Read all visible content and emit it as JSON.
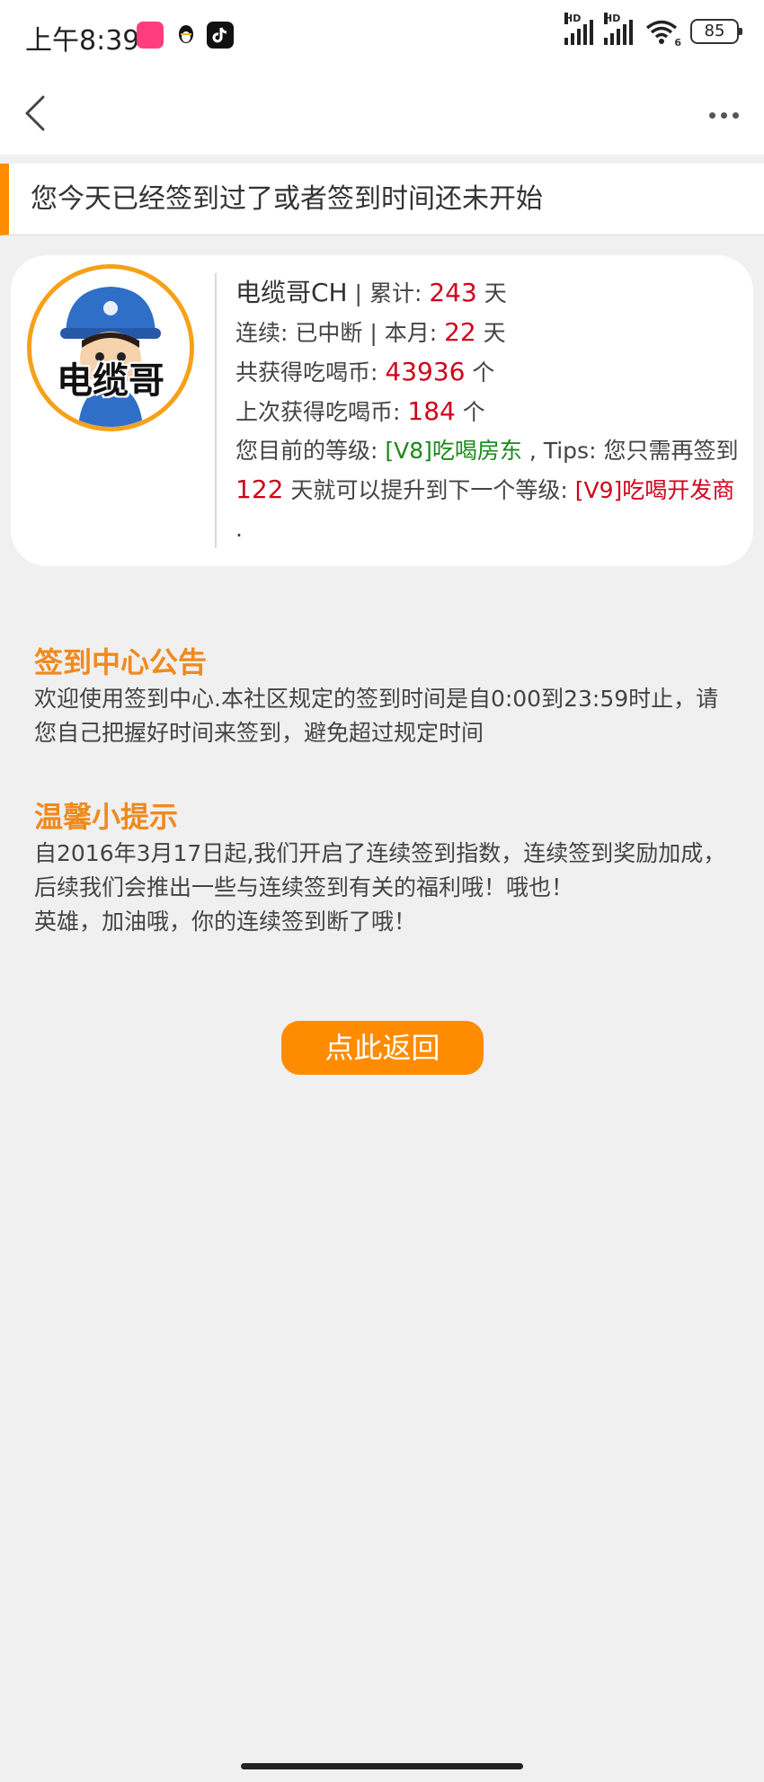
{
  "status_bar": {
    "time": "上午8:39",
    "battery": "85",
    "hd_label": "HD",
    "wifi_label": "6"
  },
  "notice": "您今天已经签到过了或者签到时间还未开始",
  "user": {
    "name": "电缆哥CH",
    "avatar_text": "电缆哥",
    "sep": " | ",
    "total_label": "累计: ",
    "total_days": "243",
    "day_unit": " 天",
    "streak_label": "连续: 已中断",
    "month_label": "本月: ",
    "month_days": "22",
    "coins_label": "共获得吃喝币: ",
    "coins": "43936",
    "coin_unit": " 个",
    "last_label": "上次获得吃喝币: ",
    "last_coins": "184",
    "level_label": "您目前的等级: ",
    "level": "[V8]吃喝房东",
    "tips_label": " , Tips: 您只需再签到 ",
    "days_needed": "122",
    "tips_mid": " 天就可以提升到下一个等级: ",
    "next_level": "[V9]吃喝开发商",
    "tips_end": " ."
  },
  "announcement": {
    "title": "签到中心公告",
    "text": "欢迎使用签到中心.本社区规定的签到时间是自0:00到23:59时止，请您自己把握好时间来签到，避免超过规定时间"
  },
  "tips": {
    "title": "温馨小提示",
    "text1": "自2016年3月17日起,我们开启了连续签到指数，连续签到奖励加成，后续我们会推出一些与连续签到有关的福利哦！哦也！",
    "text2": "英雄，加油哦，你的连续签到断了哦！"
  },
  "return_button": "点此返回",
  "colors": {
    "accent": "#ff8c00",
    "title": "#ef8a1e",
    "value_red": "#d0021b",
    "level_green": "#1a8a1a",
    "background": "#f0f0f0"
  },
  "icons": [
    "back-arrow-icon",
    "more-icon",
    "signal-icon",
    "wifi-icon",
    "battery-icon",
    "app-icon",
    "qq-icon",
    "tiktok-icon"
  ]
}
